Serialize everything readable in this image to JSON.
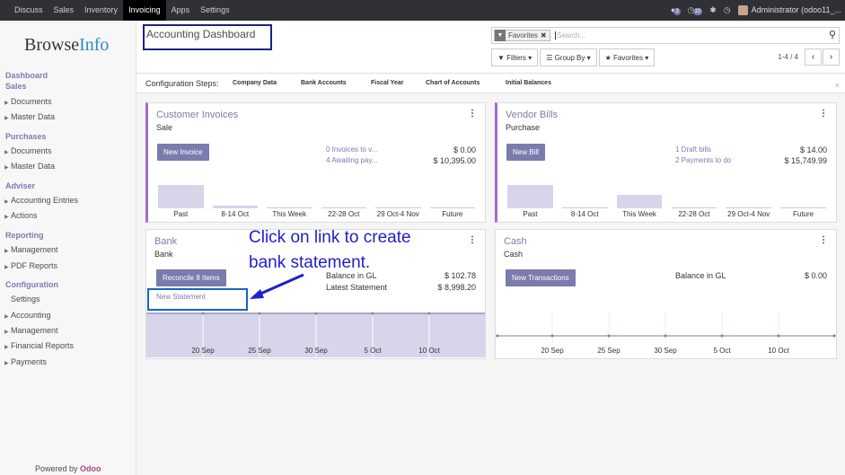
{
  "topbar": {
    "menu": [
      "Discuss",
      "Sales",
      "Inventory",
      "Invoicing",
      "Apps",
      "Settings"
    ],
    "active": "Invoicing",
    "chat_badge": "3",
    "activity_badge": "10",
    "user": "Administrator (odoo11_..."
  },
  "sidebar": {
    "logo_a": "Browse",
    "logo_b": "Info",
    "sections": [
      {
        "title": "Dashboard",
        "items": []
      },
      {
        "title": "Sales",
        "items": [
          "Documents",
          "Master Data"
        ]
      },
      {
        "title": "Purchases",
        "items": [
          "Documents",
          "Master Data"
        ]
      },
      {
        "title": "Adviser",
        "items": [
          "Accounting Entries",
          "Actions"
        ]
      },
      {
        "title": "Reporting",
        "items": [
          "Management",
          "PDF Reports"
        ]
      },
      {
        "title": "Configuration",
        "items": [
          "Settings",
          "Accounting",
          "Management",
          "Financial Reports",
          "Payments"
        ]
      }
    ],
    "powered": "Powered by",
    "powered_brand": "Odoo"
  },
  "control": {
    "title": "Accounting Dashboard",
    "facet": "Favorites",
    "search_placeholder": "Search...",
    "filters": "Filters",
    "groupby": "Group By",
    "favorites": "Favorites",
    "pager": "1-4 / 4"
  },
  "config": {
    "label": "Configuration Steps:",
    "steps": [
      "Company Data",
      "Bank Accounts",
      "Fiscal Year",
      "Chart of Accounts",
      "Initial Balances"
    ]
  },
  "cards": {
    "customer": {
      "title": "Customer Invoices",
      "sub": "Sale",
      "button": "New Invoice",
      "l1": "0 Invoices to v...",
      "a1": "$ 0.00",
      "l2": "4 Awaiting pay...",
      "a2": "$ 10,395.00",
      "labels": [
        "Past",
        "8-14 Oct",
        "This Week",
        "22-28 Oct",
        "29 Oct-4 Nov",
        "Future"
      ],
      "values": [
        6.2,
        0.6,
        0,
        0,
        0,
        0
      ]
    },
    "vendor": {
      "title": "Vendor Bills",
      "sub": "Purchase",
      "button": "New Bill",
      "l1": "1 Draft bills",
      "a1": "$ 14.00",
      "l2": "2 Payments to do",
      "a2": "$ 15,749.99",
      "labels": [
        "Past",
        "8-14 Oct",
        "This Week",
        "22-28 Oct",
        "29 Oct-4 Nov",
        "Future"
      ],
      "values": [
        6.2,
        0,
        3.5,
        0,
        0,
        0
      ]
    },
    "bank": {
      "title": "Bank",
      "sub": "Bank",
      "button": "Reconcile 8 Items",
      "link": "New Statement",
      "t1": "Balance in GL",
      "a1": "$ 102.78",
      "t2": "Latest Statement",
      "a2": "$ 8,998.20",
      "dates": [
        "20 Sep",
        "25 Sep",
        "30 Sep",
        "5 Oct",
        "10 Oct"
      ]
    },
    "cash": {
      "title": "Cash",
      "sub": "Cash",
      "button": "New Transactions",
      "t1": "Balance in GL",
      "a1": "$ 0.00",
      "dates": [
        "20 Sep",
        "25 Sep",
        "30 Sep",
        "5 Oct",
        "10 Oct"
      ]
    }
  },
  "annotation": {
    "line1": "Click on link to create",
    "line2": "bank statement."
  },
  "colors": {
    "accent": "#7c7bad",
    "topbar": "#2f3136",
    "annotation": "#1f1fcc"
  }
}
